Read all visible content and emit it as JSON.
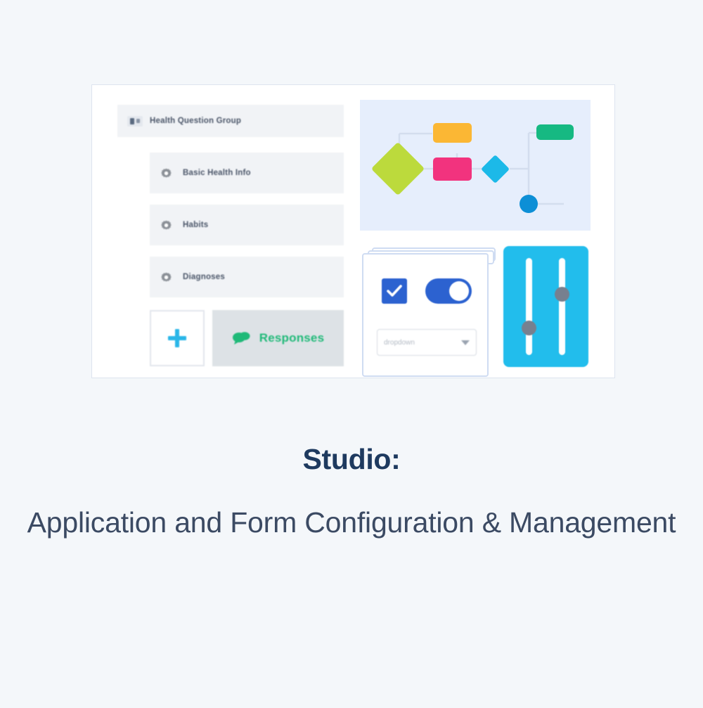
{
  "page": {
    "background_color": "#f4f7fa"
  },
  "illustration": {
    "card_background": "#ffffff",
    "card_border_color": "#dde4ef",
    "question_group": {
      "header": {
        "title": "Health Question Group",
        "icon_left": "drag-handle-icon",
        "icon_right": "collapse-icon"
      },
      "items": [
        {
          "label": "Basic Health Info",
          "icon": "gear-icon"
        },
        {
          "label": "Habits",
          "icon": "gear-icon"
        },
        {
          "label": "Diagnoses",
          "icon": "gear-icon"
        }
      ],
      "actions": {
        "add_label": "+",
        "add_icon": "plus-icon",
        "add_color": "#29b6e8",
        "responses_label": "Responses",
        "responses_icon": "chat-bubble-icon",
        "responses_color": "#1fb978"
      }
    },
    "flow_diagram": {
      "panel_background": "#e6eefc",
      "connector_color": "#d3ddee",
      "nodes": [
        {
          "name": "decision-node-lime",
          "shape": "diamond",
          "color": "#bcda3c"
        },
        {
          "name": "process-node-orange",
          "shape": "rectangle",
          "color": "#fbb734"
        },
        {
          "name": "process-node-pink",
          "shape": "rectangle",
          "color": "#f2337e"
        },
        {
          "name": "decision-node-cyan",
          "shape": "diamond",
          "color": "#1cb9e8"
        },
        {
          "name": "end-node-green",
          "shape": "rectangle",
          "color": "#16b982"
        },
        {
          "name": "endpoint-node-blue",
          "shape": "circle",
          "color": "#0d8fd6"
        }
      ]
    },
    "form_controls": {
      "checkbox": {
        "state": "checked",
        "color": "#2c62d0"
      },
      "toggle": {
        "state": "on",
        "color": "#2c62d0"
      },
      "select": {
        "value": "dropdown",
        "placeholder": "dropdown"
      }
    },
    "sliders": {
      "panel_color": "#22bdec",
      "track_color": "#ffffff",
      "knob_color": "#77808f",
      "items": [
        {
          "name": "slider-left",
          "value": 35
        },
        {
          "name": "slider-right",
          "value": 68
        }
      ]
    }
  },
  "caption": {
    "eyebrow": "Studio:",
    "title": "Application and Form Configuration & Management",
    "eyebrow_color": "#1e3a5f",
    "title_color": "#3b4a63"
  }
}
